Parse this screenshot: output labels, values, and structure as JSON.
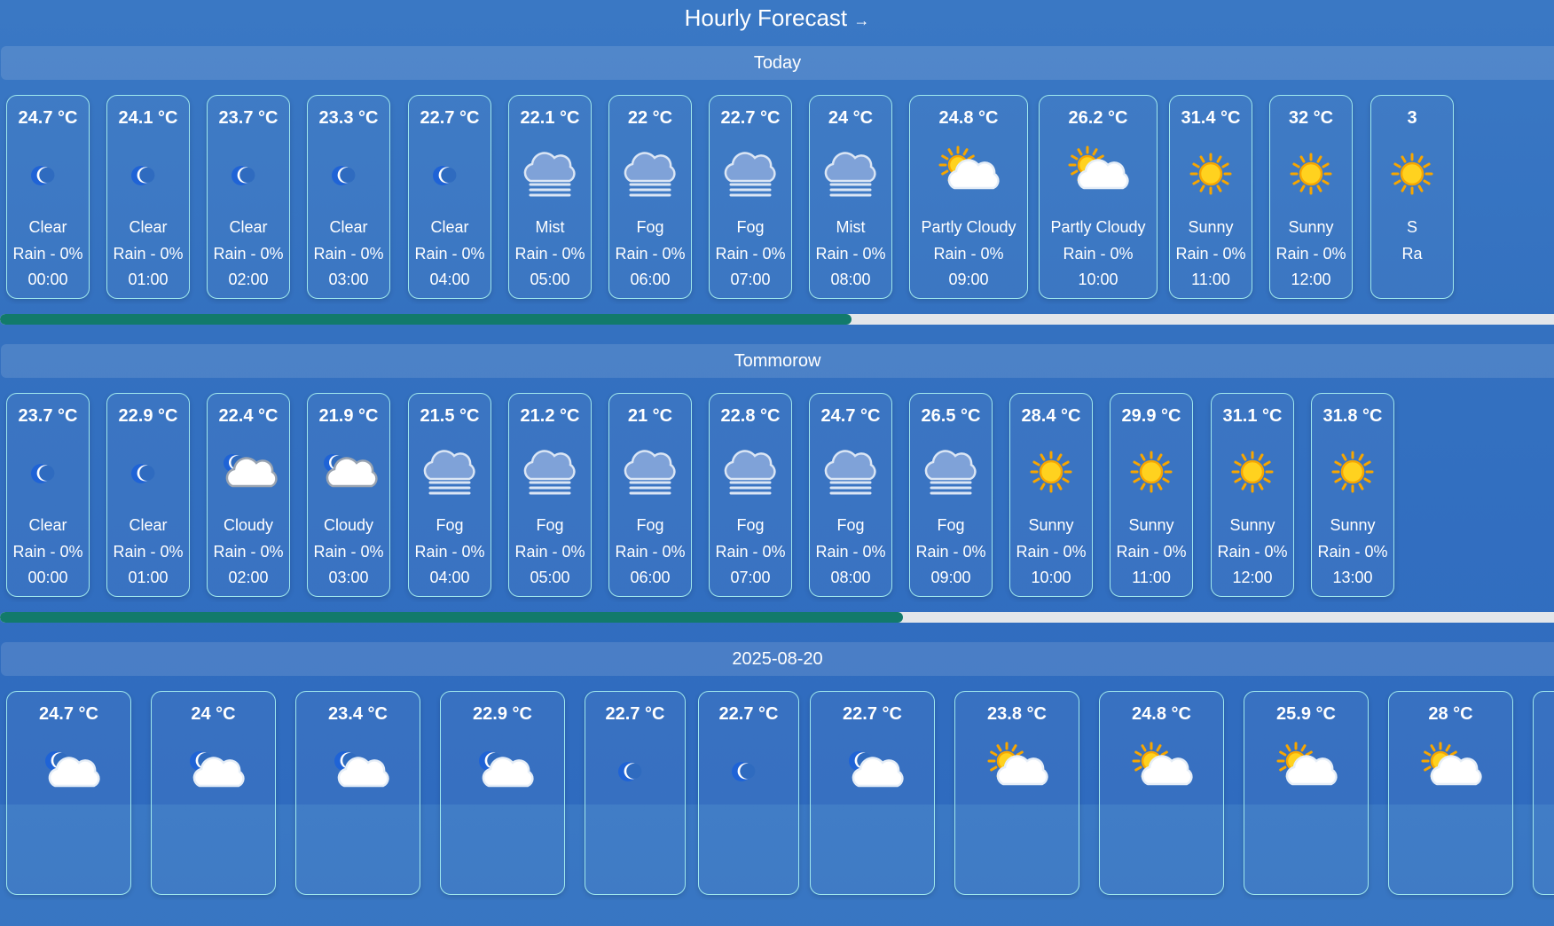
{
  "page": {
    "title": "Hourly Forecast",
    "arrow": "→"
  },
  "days": [
    {
      "label": "Today",
      "progress": 0.548,
      "cards": [
        {
          "temp": "24.7 °C",
          "icon": "moon-icon",
          "condition": "Clear",
          "rain": "Rain - 0%",
          "time": "00:00"
        },
        {
          "temp": "24.1 °C",
          "icon": "moon-icon",
          "condition": "Clear",
          "rain": "Rain - 0%",
          "time": "01:00"
        },
        {
          "temp": "23.7 °C",
          "icon": "moon-icon",
          "condition": "Clear",
          "rain": "Rain - 0%",
          "time": "02:00"
        },
        {
          "temp": "23.3 °C",
          "icon": "moon-icon",
          "condition": "Clear",
          "rain": "Rain - 0%",
          "time": "03:00"
        },
        {
          "temp": "22.7 °C",
          "icon": "moon-icon",
          "condition": "Clear",
          "rain": "Rain - 0%",
          "time": "04:00"
        },
        {
          "temp": "22.1 °C",
          "icon": "fog-icon",
          "condition": "Mist",
          "rain": "Rain - 0%",
          "time": "05:00"
        },
        {
          "temp": "22 °C",
          "icon": "fog-icon",
          "condition": "Fog",
          "rain": "Rain - 0%",
          "time": "06:00"
        },
        {
          "temp": "22.7 °C",
          "icon": "fog-icon",
          "condition": "Fog",
          "rain": "Rain - 0%",
          "time": "07:00"
        },
        {
          "temp": "24 °C",
          "icon": "fog-icon",
          "condition": "Mist",
          "rain": "Rain - 0%",
          "time": "08:00"
        },
        {
          "temp": "24.8 °C",
          "icon": "sun-cloud-icon",
          "condition": "Partly Cloudy",
          "rain": "Rain - 0%",
          "time": "09:00"
        },
        {
          "temp": "26.2 °C",
          "icon": "sun-cloud-icon",
          "condition": "Partly Cloudy",
          "rain": "Rain - 0%",
          "time": "10:00"
        },
        {
          "temp": "31.4 °C",
          "icon": "sun-icon",
          "condition": "Sunny",
          "rain": "Rain - 0%",
          "time": "11:00"
        },
        {
          "temp": "32 °C",
          "icon": "sun-icon",
          "condition": "Sunny",
          "rain": "Rain - 0%",
          "time": "12:00"
        },
        {
          "temp": "3",
          "icon": "sun-icon",
          "condition": "S",
          "rain": "Ra",
          "time": ""
        }
      ]
    },
    {
      "label": "Tommorow",
      "progress": 0.581,
      "cards": [
        {
          "temp": "23.7 °C",
          "icon": "moon-icon",
          "condition": "Clear",
          "rain": "Rain - 0%",
          "time": "00:00"
        },
        {
          "temp": "22.9 °C",
          "icon": "moon-icon",
          "condition": "Clear",
          "rain": "Rain - 0%",
          "time": "01:00"
        },
        {
          "temp": "22.4 °C",
          "icon": "moon-cloud-grey-icon",
          "condition": "Cloudy",
          "rain": "Rain - 0%",
          "time": "02:00"
        },
        {
          "temp": "21.9 °C",
          "icon": "moon-cloud-grey-icon",
          "condition": "Cloudy",
          "rain": "Rain - 0%",
          "time": "03:00"
        },
        {
          "temp": "21.5 °C",
          "icon": "fog-icon",
          "condition": "Fog",
          "rain": "Rain - 0%",
          "time": "04:00"
        },
        {
          "temp": "21.2 °C",
          "icon": "fog-icon",
          "condition": "Fog",
          "rain": "Rain - 0%",
          "time": "05:00"
        },
        {
          "temp": "21 °C",
          "icon": "fog-icon",
          "condition": "Fog",
          "rain": "Rain - 0%",
          "time": "06:00"
        },
        {
          "temp": "22.8 °C",
          "icon": "fog-icon",
          "condition": "Fog",
          "rain": "Rain - 0%",
          "time": "07:00"
        },
        {
          "temp": "24.7 °C",
          "icon": "fog-icon",
          "condition": "Fog",
          "rain": "Rain - 0%",
          "time": "08:00"
        },
        {
          "temp": "26.5 °C",
          "icon": "fog-icon",
          "condition": "Fog",
          "rain": "Rain - 0%",
          "time": "09:00"
        },
        {
          "temp": "28.4 °C",
          "icon": "sun-icon",
          "condition": "Sunny",
          "rain": "Rain - 0%",
          "time": "10:00"
        },
        {
          "temp": "29.9 °C",
          "icon": "sun-icon",
          "condition": "Sunny",
          "rain": "Rain - 0%",
          "time": "11:00"
        },
        {
          "temp": "31.1 °C",
          "icon": "sun-icon",
          "condition": "Sunny",
          "rain": "Rain - 0%",
          "time": "12:00"
        },
        {
          "temp": "31.8 °C",
          "icon": "sun-icon",
          "condition": "Sunny",
          "rain": "Rain - 0%",
          "time": "13:00"
        }
      ]
    },
    {
      "label": "2025-08-20",
      "progress": 0,
      "cards": [
        {
          "temp": "24.7 °C",
          "icon": "moon-cloud-icon",
          "condition": "",
          "rain": "",
          "time": ""
        },
        {
          "temp": "24 °C",
          "icon": "moon-cloud-icon",
          "condition": "",
          "rain": "",
          "time": ""
        },
        {
          "temp": "23.4 °C",
          "icon": "moon-cloud-icon",
          "condition": "",
          "rain": "",
          "time": ""
        },
        {
          "temp": "22.9 °C",
          "icon": "moon-cloud-icon",
          "condition": "",
          "rain": "",
          "time": ""
        },
        {
          "temp": "22.7 °C",
          "icon": "moon-icon",
          "condition": "",
          "rain": "",
          "time": ""
        },
        {
          "temp": "22.7 °C",
          "icon": "moon-icon",
          "condition": "",
          "rain": "",
          "time": ""
        },
        {
          "temp": "22.7 °C",
          "icon": "moon-cloud-icon",
          "condition": "",
          "rain": "",
          "time": ""
        },
        {
          "temp": "23.8 °C",
          "icon": "sun-cloud-icon",
          "condition": "",
          "rain": "",
          "time": ""
        },
        {
          "temp": "24.8 °C",
          "icon": "sun-cloud-icon",
          "condition": "",
          "rain": "",
          "time": ""
        },
        {
          "temp": "25.9 °C",
          "icon": "sun-cloud-icon",
          "condition": "",
          "rain": "",
          "time": ""
        },
        {
          "temp": "28 °C",
          "icon": "sun-cloud-icon",
          "condition": "",
          "rain": "",
          "time": ""
        },
        {
          "temp": "",
          "icon": "",
          "condition": "",
          "rain": "",
          "time": ""
        }
      ]
    }
  ]
}
